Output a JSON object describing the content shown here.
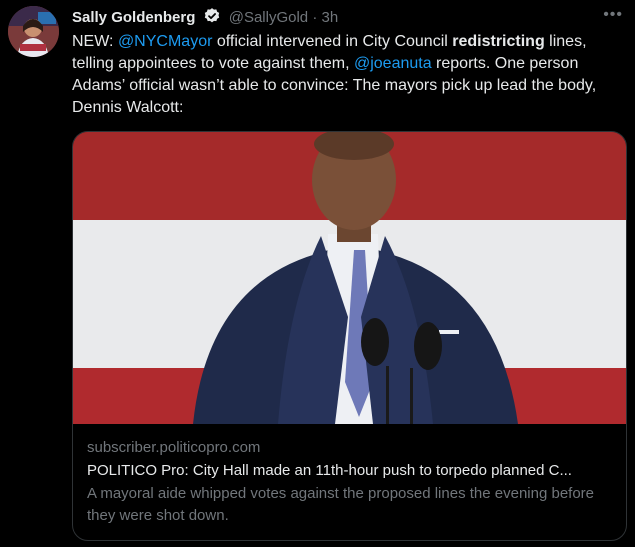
{
  "author": {
    "name": "Sally Goldenberg",
    "handle": "@SallyGold",
    "separator": "·",
    "time": "3h"
  },
  "more_label": "•••",
  "tweet": {
    "t1": "NEW: ",
    "m1": "@NYCMayor",
    "t2": " official intervened in City Council ",
    "b1": "redistricting",
    "t3": " lines, telling appointees to vote against them, ",
    "m2": "@joeanuta",
    "t4": " reports. One person Adams’ official wasn’t able to convince: The mayors pick up lead the body, Dennis Walcott:"
  },
  "card": {
    "domain": "subscriber.politicopro.com",
    "title": "POLITICO Pro: City Hall made an 11th-hour push to torpedo planned C...",
    "description": "A mayoral aide whipped votes against the proposed lines the evening before they were shot down."
  },
  "colors": {
    "background": "#000000",
    "text": "#e7e9ea",
    "muted": "#71767b",
    "link": "#1d9bf0",
    "border": "#2f3336"
  },
  "icons": {
    "verified": "verified-badge-icon",
    "more": "more-dots-icon"
  }
}
